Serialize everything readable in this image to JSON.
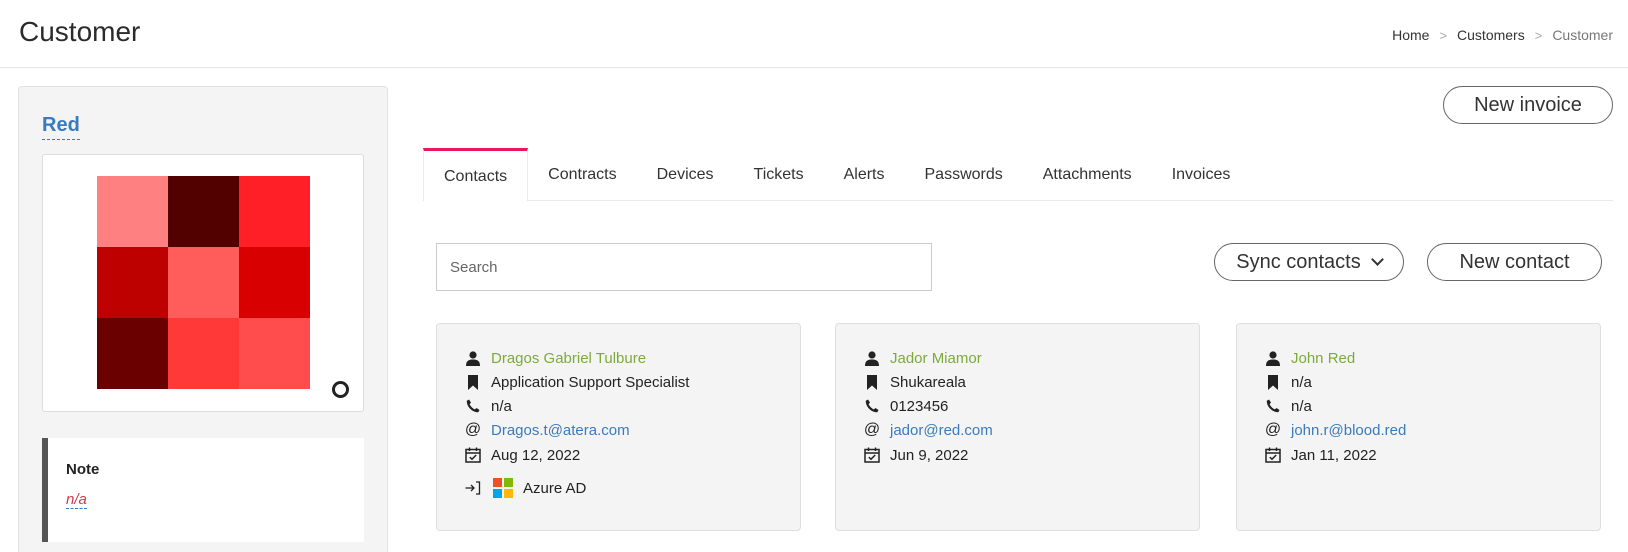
{
  "header": {
    "title": "Customer",
    "breadcrumb": [
      {
        "label": "Home"
      },
      {
        "label": "Customers"
      },
      {
        "label": "Customer"
      }
    ]
  },
  "customer": {
    "name": "Red",
    "logo_colors": [
      "#ff8080",
      "#520000",
      "#ff1f26",
      "#bd0000",
      "#ff5c5c",
      "#d80000",
      "#6b0000",
      "#ff3838",
      "#ff4d4d"
    ],
    "note_title": "Note",
    "note_value": "n/a"
  },
  "toolbar": {
    "new_invoice_label": "New invoice"
  },
  "tabs": [
    {
      "label": "Contacts",
      "active": true
    },
    {
      "label": "Contracts"
    },
    {
      "label": "Devices"
    },
    {
      "label": "Tickets"
    },
    {
      "label": "Alerts"
    },
    {
      "label": "Passwords"
    },
    {
      "label": "Attachments"
    },
    {
      "label": "Invoices"
    }
  ],
  "contacts_toolbar": {
    "search_placeholder": "Search",
    "sync_label": "Sync contacts",
    "new_contact_label": "New contact"
  },
  "contacts": [
    {
      "name": "Dragos Gabriel Tulbure",
      "title": "Application Support Specialist",
      "phone": "n/a",
      "email": "Dragos.t@atera.com",
      "date": "Aug 12, 2022",
      "source": "Azure AD"
    },
    {
      "name": "Jador Miamor",
      "title": "Shukareala",
      "phone": "0123456",
      "email": "jador@red.com",
      "date": "Jun 9, 2022"
    },
    {
      "name": "John Red",
      "title": "n/a",
      "phone": "n/a",
      "email": "john.r@blood.red",
      "date": "Jan 11, 2022"
    }
  ]
}
